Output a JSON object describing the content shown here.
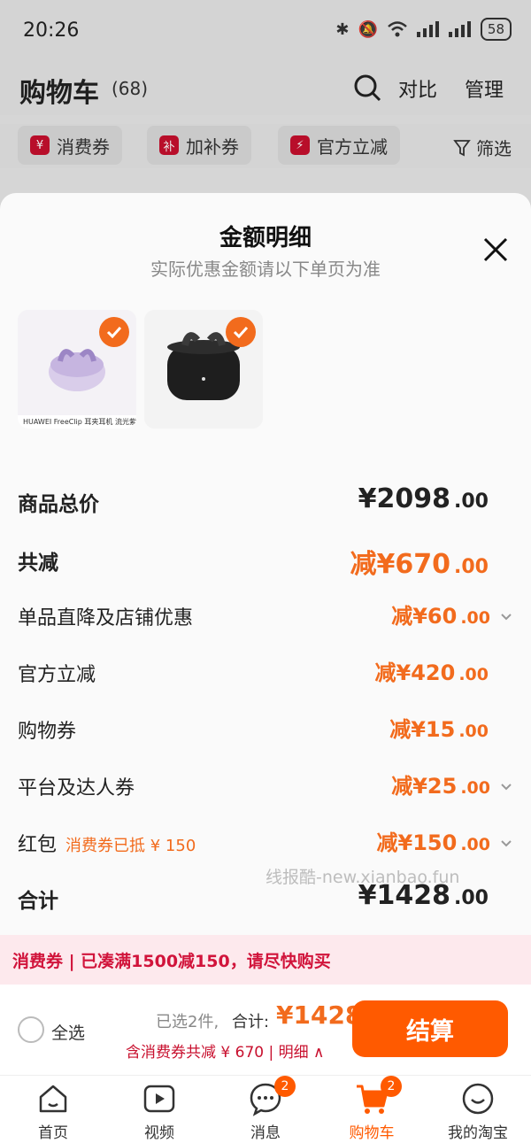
{
  "status_bar": {
    "time": "20:26",
    "battery": "58"
  },
  "header": {
    "title": "购物车",
    "count": "(68)",
    "compare": "对比",
    "manage": "管理"
  },
  "chips": [
    {
      "badge": "¥",
      "label": "消费券"
    },
    {
      "badge": "补",
      "label": "加补券"
    },
    {
      "badge": "⚡",
      "label": "官方立减"
    }
  ],
  "filter_label": "筛选",
  "sheet": {
    "title": "金额明细",
    "subtitle": "实际优惠金额请以下单页为准",
    "thumb_caption": "HUAWEI FreeClip 耳夹耳机 流光紫",
    "rows": {
      "subtotal": {
        "label": "商品总价",
        "int": "¥2098",
        "dec": ".00"
      },
      "total_reduce": {
        "label": "共减",
        "int": "减¥670",
        "dec": ".00"
      },
      "shop_discount": {
        "label": "单品直降及店铺优惠",
        "int": "减¥60",
        "dec": ".00"
      },
      "official": {
        "label": "官方立减",
        "int": "减¥420",
        "dec": ".00"
      },
      "shopping_coupon": {
        "label": "购物券",
        "int": "减¥15",
        "dec": ".00"
      },
      "platform": {
        "label": "平台及达人券",
        "int": "减¥25",
        "dec": ".00"
      },
      "red_packet": {
        "label": "红包",
        "note": "消费券已抵 ¥ 150",
        "int": "减¥150",
        "dec": ".00"
      },
      "grand_total": {
        "label": "合计",
        "int": "¥1428",
        "dec": ".00"
      }
    },
    "watermark": "线报酷-new.xianbao.fun"
  },
  "promo": {
    "text": "消费券 | 已凑满1500减150，请尽快购买"
  },
  "checkout": {
    "select_all": "全选",
    "selected": "已选2件,",
    "total_label": "合计:",
    "total_value": "¥1428",
    "discount_line": "含消费券共减 ¥ 670 | 明细 ∧",
    "button": "结算"
  },
  "tabs": [
    {
      "label": "首页"
    },
    {
      "label": "视频"
    },
    {
      "label": "消息",
      "badge": "2"
    },
    {
      "label": "购物车",
      "badge": "2"
    },
    {
      "label": "我的淘宝"
    }
  ],
  "colors": {
    "accent": "#ff5a00",
    "discount": "#f26b1d",
    "promo_red": "#d1143b"
  }
}
